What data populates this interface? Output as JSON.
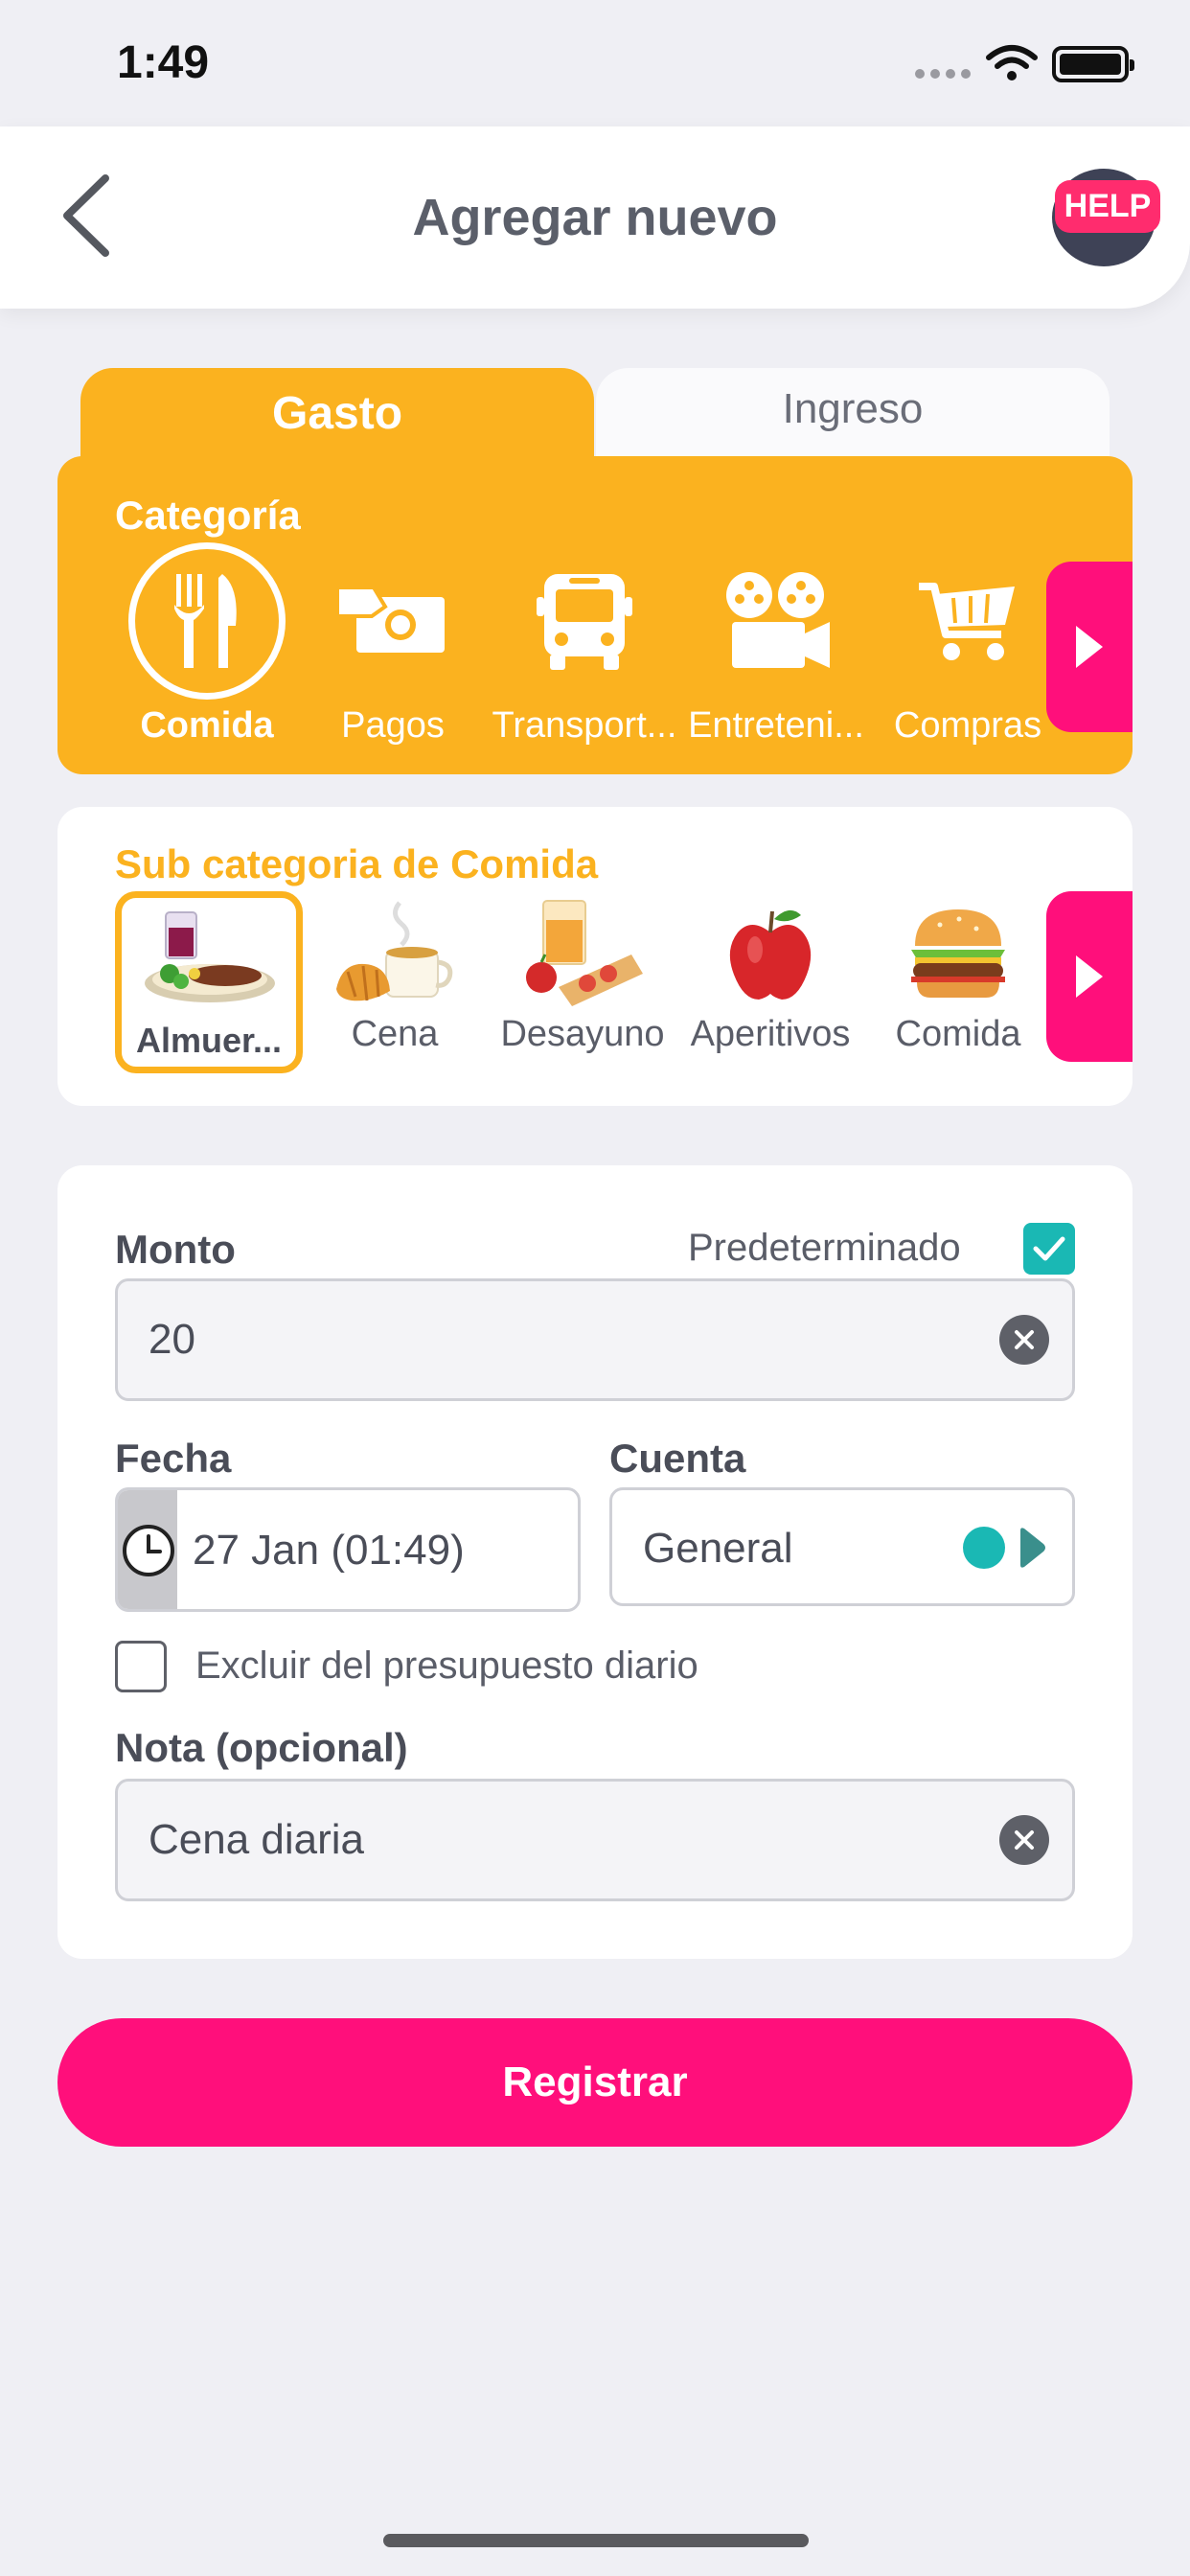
{
  "status_bar": {
    "time": "1:49"
  },
  "header": {
    "title": "Agregar nuevo",
    "help_label": "HELP"
  },
  "tabs": [
    {
      "label": "Gasto",
      "selected": true
    },
    {
      "label": "Ingreso",
      "selected": false
    }
  ],
  "category": {
    "title": "Categoría",
    "items": [
      {
        "label": "Comida",
        "icon": "fork-knife-icon",
        "selected": true
      },
      {
        "label": "Pagos",
        "icon": "cash-icon",
        "selected": false
      },
      {
        "label": "Transport...",
        "icon": "bus-icon",
        "selected": false
      },
      {
        "label": "Entreteni...",
        "icon": "movie-camera-icon",
        "selected": false
      },
      {
        "label": "Compras",
        "icon": "shopping-cart-icon",
        "selected": false
      }
    ]
  },
  "subcategory": {
    "title": "Sub categoria de Comida",
    "items": [
      {
        "label": "Almuer...",
        "icon": "lunch-plate-icon",
        "selected": true
      },
      {
        "label": "Cena",
        "icon": "coffee-croissant-icon",
        "selected": false
      },
      {
        "label": "Desayuno",
        "icon": "breakfast-icon",
        "selected": false
      },
      {
        "label": "Aperitivos",
        "icon": "apple-icon",
        "selected": false
      },
      {
        "label": "Comida",
        "icon": "burger-icon",
        "selected": false
      }
    ]
  },
  "form": {
    "amount_label": "Monto",
    "default_label": "Predeterminado",
    "default_checked": true,
    "amount_value": "20",
    "date_label": "Fecha",
    "date_value": "27 Jan (01:49)",
    "account_label": "Cuenta",
    "account_value": "General",
    "exclude_label": "Excluir del presupuesto diario",
    "exclude_checked": false,
    "note_label": "Nota (opcional)",
    "note_value": "Cena diaria"
  },
  "register_label": "Registrar",
  "colors": {
    "accent_orange": "#fbb21f",
    "accent_pink": "#ff0f7b",
    "teal": "#1ab8b4"
  }
}
